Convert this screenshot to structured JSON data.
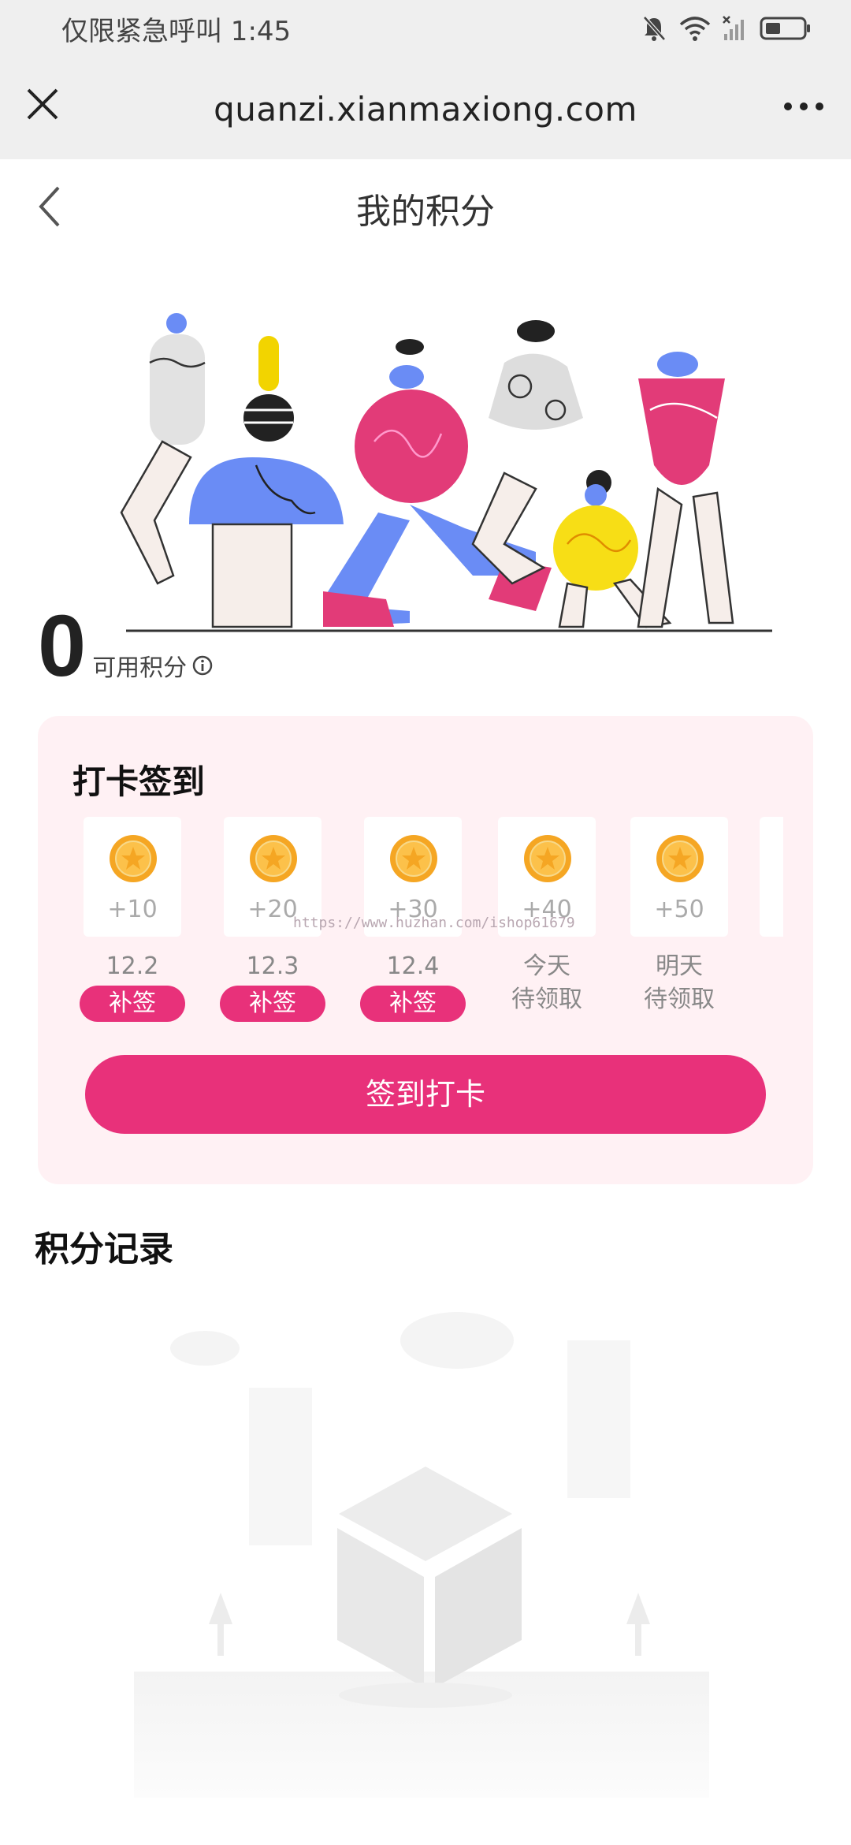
{
  "status_bar": {
    "text": "仅限紧急呼叫 1:45",
    "icons": [
      "mute-bell-icon",
      "wifi-icon",
      "no-signal-icon",
      "battery-icon"
    ]
  },
  "browser": {
    "url": "quanzi.xianmaxiong.com",
    "close_icon": "close-icon",
    "more_icon": "more-icon"
  },
  "nav": {
    "title": "我的积分",
    "back_icon": "chevron-left-icon"
  },
  "points": {
    "value": "0",
    "label": "可用积分",
    "info_icon": "info-icon"
  },
  "checkin": {
    "title": "打卡签到",
    "days": [
      {
        "points": "+10",
        "date": "12.2",
        "action": "补签"
      },
      {
        "points": "+20",
        "date": "12.3",
        "action": "补签"
      },
      {
        "points": "+30",
        "date": "12.4",
        "action": "补签"
      },
      {
        "points": "+40",
        "date": "今天",
        "status": "待领取"
      },
      {
        "points": "+50",
        "date": "明天",
        "status": "待领取"
      }
    ],
    "button_label": "签到打卡"
  },
  "watermark": "https://www.huzhan.com/ishop61679",
  "records": {
    "title": "积分记录"
  },
  "colors": {
    "accent": "#e8317a",
    "card_bg": "#fff1f4",
    "bar_bg": "#efefef",
    "coin": "#f5a623"
  }
}
